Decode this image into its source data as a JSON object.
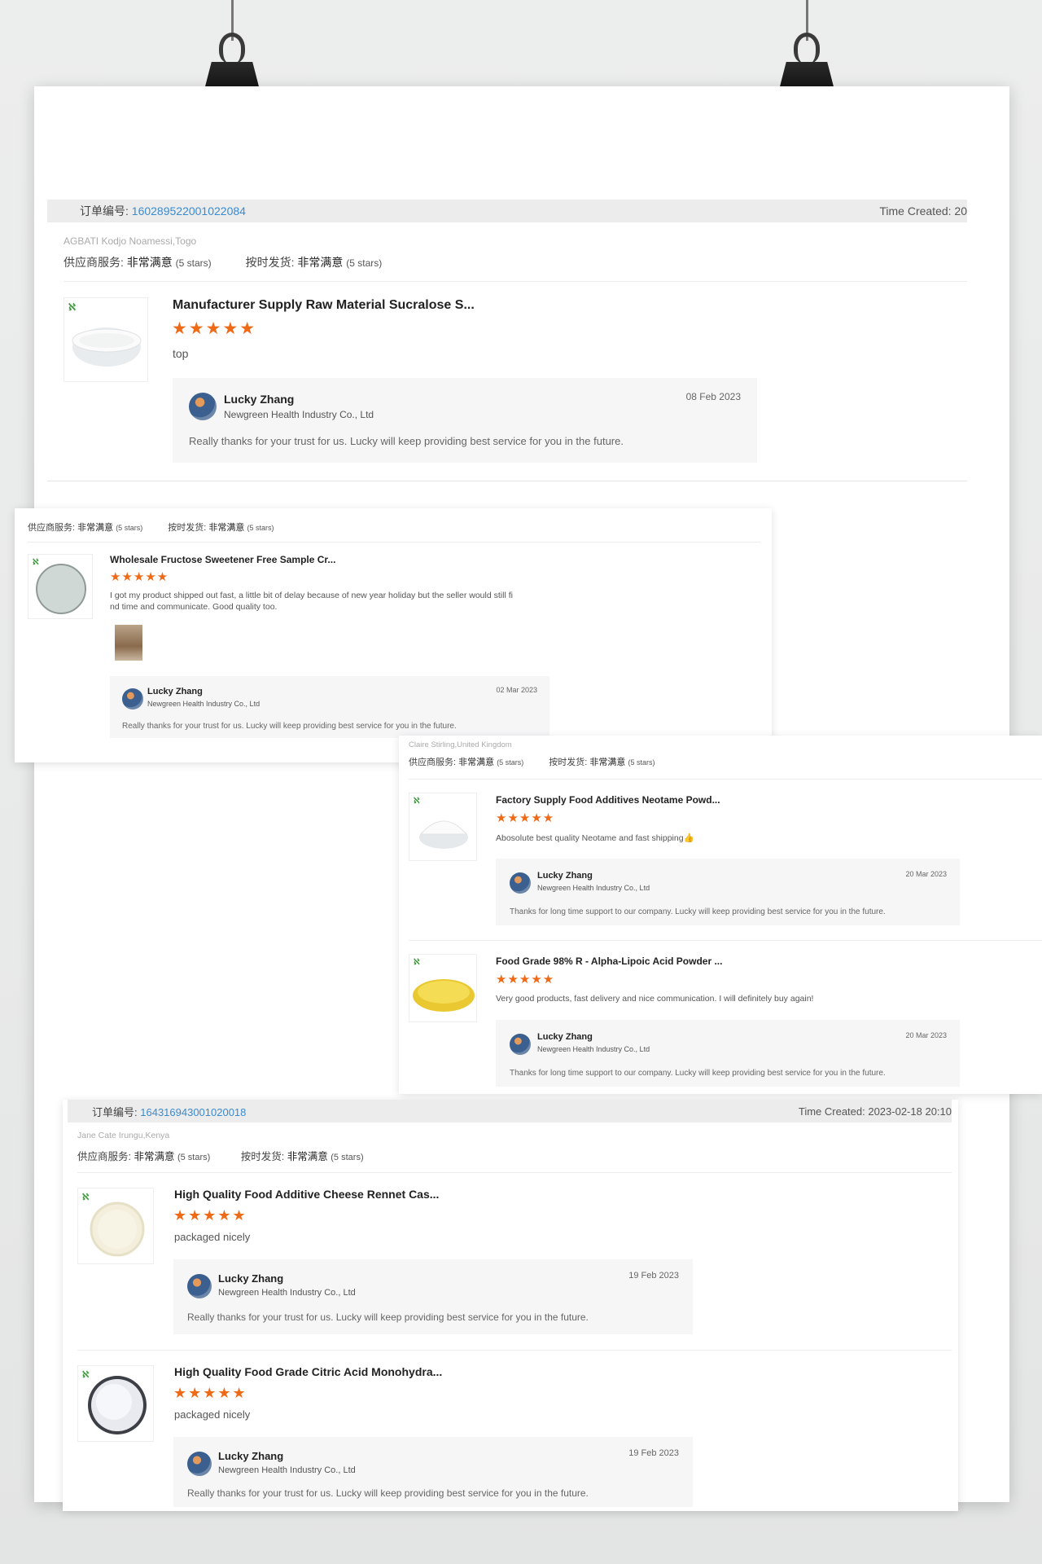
{
  "order1": {
    "label": "订单编号:",
    "number": "160289522001022084",
    "time": "Time Created: 20",
    "buyer": "AGBATI Kodjo Noamessi,Togo",
    "supplier_label": "供应商服务:",
    "supplier_value": "非常满意",
    "supplier_stars": "(5 stars)",
    "shipping_label": "按时发货:",
    "shipping_value": "非常满意",
    "shipping_stars": "(5 stars)",
    "product": {
      "title": "Manufacturer Supply Raw Material Sucralose S...",
      "stars": "★★★★★",
      "review": "top",
      "reply": {
        "name": "Lucky Zhang",
        "company": "Newgreen Health Industry Co., Ltd",
        "date": "08 Feb 2023",
        "text": "Really thanks for your trust for us. Lucky will keep providing best service for you in the future."
      }
    }
  },
  "order2": {
    "supplier_label": "供应商服务:",
    "supplier_value": "非常满意",
    "supplier_stars": "(5 stars)",
    "shipping_label": "按时发货:",
    "shipping_value": "非常满意",
    "shipping_stars": "(5 stars)",
    "product": {
      "title": "Wholesale Fructose Sweetener Free Sample Cr...",
      "stars": "★★★★★",
      "review_line1": "I got my product shipped out fast, a little bit of delay because of new year holiday but the seller would still fi",
      "review_line2": "nd time and communicate. Good quality too.",
      "reply": {
        "name": "Lucky Zhang",
        "company": "Newgreen Health Industry Co., Ltd",
        "date": "02 Mar 2023",
        "text": "Really thanks for your trust for us. Lucky will keep providing best service for you in the future."
      }
    }
  },
  "order3": {
    "buyer": "Claire Stirling,United Kingdom",
    "supplier_label": "供应商服务:",
    "supplier_value": "非常满意",
    "supplier_stars": "(5 stars)",
    "shipping_label": "按时发货:",
    "shipping_value": "非常满意",
    "shipping_stars": "(5 stars)",
    "products": [
      {
        "title": "Factory Supply Food Additives Neotame Powd...",
        "stars": "★★★★★",
        "review": "Abosolute best quality Neotame and fast shipping👍",
        "reply": {
          "name": "Lucky Zhang",
          "company": "Newgreen Health Industry Co., Ltd",
          "date": "20 Mar 2023",
          "text": "Thanks for long time support to our company. Lucky will keep providing best service for you in the future."
        }
      },
      {
        "title": "Food Grade 98% R - Alpha-Lipoic Acid Powder ...",
        "stars": "★★★★★",
        "review": "Very good products, fast delivery and nice communication. I will definitely buy again!",
        "reply": {
          "name": "Lucky Zhang",
          "company": "Newgreen Health Industry Co., Ltd",
          "date": "20 Mar 2023",
          "text": "Thanks for long time support to our company. Lucky will keep providing best service for you in the future."
        }
      }
    ]
  },
  "order4": {
    "label": "订单编号:",
    "number": "164316943001020018",
    "time": "Time Created: 2023-02-18 20:10",
    "buyer": "Jane Cate Irungu,Kenya",
    "supplier_label": "供应商服务:",
    "supplier_value": "非常满意",
    "supplier_stars": "(5 stars)",
    "shipping_label": "按时发货:",
    "shipping_value": "非常满意",
    "shipping_stars": "(5 stars)",
    "products": [
      {
        "title": "High Quality Food Additive Cheese Rennet Cas...",
        "stars": "★★★★★",
        "review": "packaged nicely",
        "reply": {
          "name": "Lucky Zhang",
          "company": "Newgreen Health Industry Co., Ltd",
          "date": "19 Feb 2023",
          "text": "Really thanks for your trust for us. Lucky will keep providing best service for you in the future."
        }
      },
      {
        "title": "High Quality Food Grade Citric Acid Monohydra...",
        "stars": "★★★★★",
        "review": "packaged nicely",
        "reply": {
          "name": "Lucky Zhang",
          "company": "Newgreen Health Industry Co., Ltd",
          "date": "19 Feb 2023",
          "text": "Really thanks for your trust for us. Lucky will keep providing best service for you in the future."
        }
      }
    ]
  }
}
